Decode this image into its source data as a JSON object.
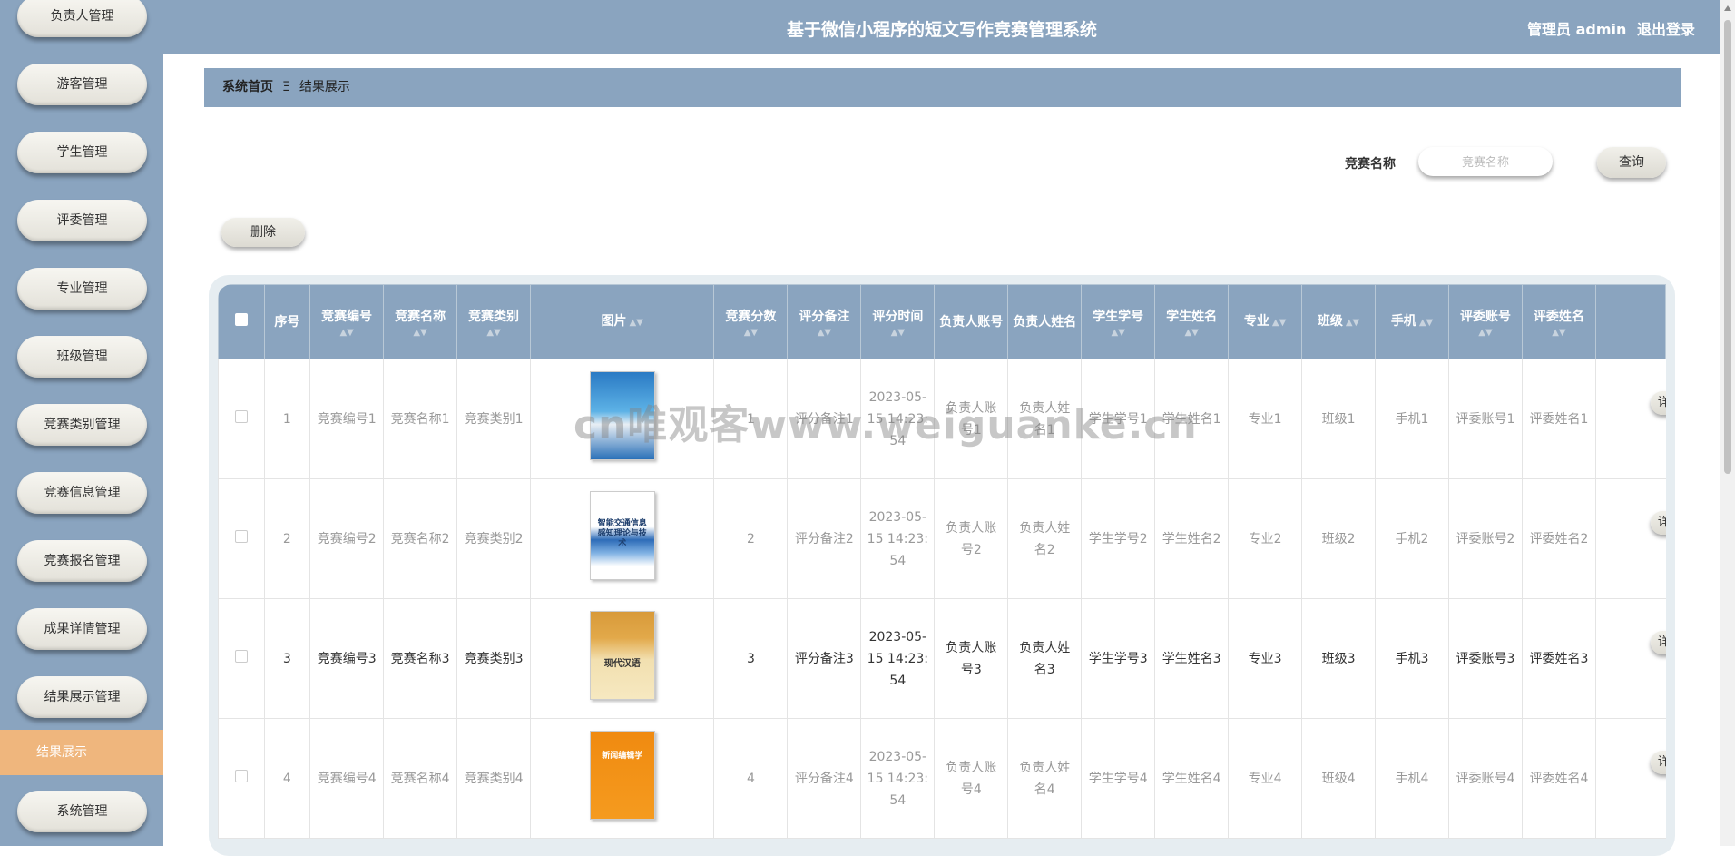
{
  "header": {
    "title": "基于微信小程序的短文写作竞赛管理系统",
    "user": "管理员 admin",
    "logout": "退出登录"
  },
  "sidebar": {
    "items": [
      "负责人管理",
      "游客管理",
      "学生管理",
      "评委管理",
      "专业管理",
      "班级管理",
      "竞赛类别管理",
      "竞赛信息管理",
      "竞赛报名管理",
      "成果详情管理",
      "结果展示管理",
      "系统管理"
    ],
    "active": "结果展示"
  },
  "breadcrumb": {
    "home": "系统首页",
    "separator": "Ξ",
    "current": "结果展示"
  },
  "search": {
    "label": "竞赛名称",
    "placeholder": "竞赛名称",
    "button": "查询"
  },
  "toolbar": {
    "delete_label": "删除"
  },
  "table": {
    "headers": [
      "序号",
      "竞赛编号",
      "竞赛名称",
      "竞赛类别",
      "图片",
      "竞赛分数",
      "评分备注",
      "评分时间",
      "负责人账号",
      "负责人姓名",
      "学生学号",
      "学生姓名",
      "专业",
      "班级",
      "手机",
      "评委账号",
      "评委姓名"
    ],
    "action_label": "详",
    "rows": [
      {
        "no": "1",
        "code": "竞赛编号1",
        "name": "竞赛名称1",
        "category": "竞赛类别1",
        "score": "1",
        "remark": "评分备注1",
        "time": "2023-05-15 14:23:54",
        "leader_account": "负责人账号1",
        "leader_name": "负责人姓名1",
        "student_no": "学生学号1",
        "student_name": "学生姓名1",
        "major": "专业1",
        "class": "班级1",
        "phone": "手机1",
        "judge_account": "评委账号1",
        "judge_name": "评委姓名1"
      },
      {
        "no": "2",
        "code": "竞赛编号2",
        "name": "竞赛名称2",
        "category": "竞赛类别2",
        "score": "2",
        "remark": "评分备注2",
        "time": "2023-05-15 14:23:54",
        "leader_account": "负责人账号2",
        "leader_name": "负责人姓名2",
        "student_no": "学生学号2",
        "student_name": "学生姓名2",
        "major": "专业2",
        "class": "班级2",
        "phone": "手机2",
        "judge_account": "评委账号2",
        "judge_name": "评委姓名2"
      },
      {
        "no": "3",
        "code": "竞赛编号3",
        "name": "竞赛名称3",
        "category": "竞赛类别3",
        "score": "3",
        "remark": "评分备注3",
        "time": "2023-05-15 14:23:54",
        "leader_account": "负责人账号3",
        "leader_name": "负责人姓名3",
        "student_no": "学生学号3",
        "student_name": "学生姓名3",
        "major": "专业3",
        "class": "班级3",
        "phone": "手机3",
        "judge_account": "评委账号3",
        "judge_name": "评委姓名3"
      },
      {
        "no": "4",
        "code": "竞赛编号4",
        "name": "竞赛名称4",
        "category": "竞赛类别4",
        "score": "4",
        "remark": "评分备注4",
        "time": "2023-05-15 14:23:54",
        "leader_account": "负责人账号4",
        "leader_name": "负责人姓名4",
        "student_no": "学生学号4",
        "student_name": "学生姓名4",
        "major": "专业4",
        "class": "班级4",
        "phone": "手机4",
        "judge_account": "评委账号4",
        "judge_name": "评委姓名4"
      }
    ],
    "images": [
      {
        "title": "",
        "icon": "book-cover-blue"
      },
      {
        "title": "智能交通信息感知理论与技术",
        "icon": "book-cover-white"
      },
      {
        "title": "现代汉语",
        "icon": "book-cover-gold"
      },
      {
        "title": "新闻编辑学",
        "icon": "book-cover-orange"
      }
    ]
  },
  "watermark": "cn唯观客www.weiguanke.cn",
  "colors": {
    "primary": "#8aa4bf",
    "active": "#efb67d"
  }
}
